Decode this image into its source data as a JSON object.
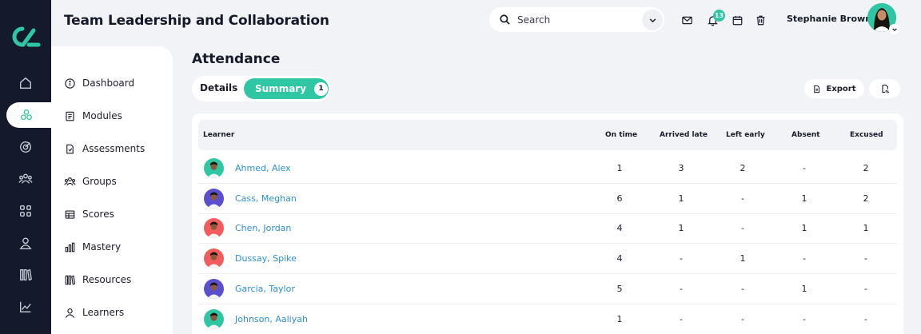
{
  "app": {
    "title": "Team Leadership and Collaboration"
  },
  "header": {
    "search_placeholder": "Search",
    "notification_count": "13",
    "user_name": "Stephanie Brown",
    "icons": [
      "mail-icon",
      "bell-icon",
      "calendar-icon",
      "trash-icon"
    ]
  },
  "rail": {
    "items": [
      "home-icon",
      "courses-icon",
      "target-icon",
      "people-icon",
      "grid-icon",
      "user-icon",
      "library-icon",
      "chart-icon"
    ],
    "active": "courses-icon"
  },
  "subnav": {
    "items": [
      {
        "label": "Dashboard",
        "icon": "info-icon"
      },
      {
        "label": "Modules",
        "icon": "book-icon"
      },
      {
        "label": "Assessments",
        "icon": "document-icon"
      },
      {
        "label": "Groups",
        "icon": "group-icon"
      },
      {
        "label": "Scores",
        "icon": "table-icon"
      },
      {
        "label": "Mastery",
        "icon": "bar-chart-icon"
      },
      {
        "label": "Resources",
        "icon": "library-icon"
      },
      {
        "label": "Learners",
        "icon": "person-icon"
      }
    ]
  },
  "main": {
    "title": "Attendance",
    "tabs": [
      {
        "label": "Details"
      },
      {
        "label": "Summary",
        "count": "1"
      }
    ],
    "active_tab": "Summary",
    "export_label": "Export",
    "table": {
      "columns": [
        "Learner",
        "On time",
        "Arrived late",
        "Left early",
        "Absent",
        "Excused"
      ],
      "rows": [
        {
          "name": "Ahmed, Alex",
          "on_time": "1",
          "late": "3",
          "left_early": "2",
          "absent": "-",
          "excused": "2",
          "avatar_color": "#2fc6a3"
        },
        {
          "name": "Cass, Meghan",
          "on_time": "6",
          "late": "1",
          "left_early": "-",
          "absent": "1",
          "excused": "2",
          "avatar_color": "#5a4fcf"
        },
        {
          "name": "Chen, Jordan",
          "on_time": "4",
          "late": "1",
          "left_early": "-",
          "absent": "1",
          "excused": "1",
          "avatar_color": "#f25c5c"
        },
        {
          "name": "Dussay, Spike",
          "on_time": "4",
          "late": "-",
          "left_early": "1",
          "absent": "-",
          "excused": "-",
          "avatar_color": "#f25c5c"
        },
        {
          "name": "Garcia, Taylor",
          "on_time": "5",
          "late": "-",
          "left_early": "-",
          "absent": "1",
          "excused": "-",
          "avatar_color": "#5a4fcf"
        },
        {
          "name": "Johnson, Aaliyah",
          "on_time": "1",
          "late": "-",
          "left_early": "-",
          "absent": "-",
          "excused": "-",
          "avatar_color": "#2fc6a3"
        }
      ]
    }
  },
  "colors": {
    "accent": "#2fc6a3",
    "rail": "#141a2b",
    "link": "#2c8fd4",
    "background": "#f2f3f6"
  }
}
